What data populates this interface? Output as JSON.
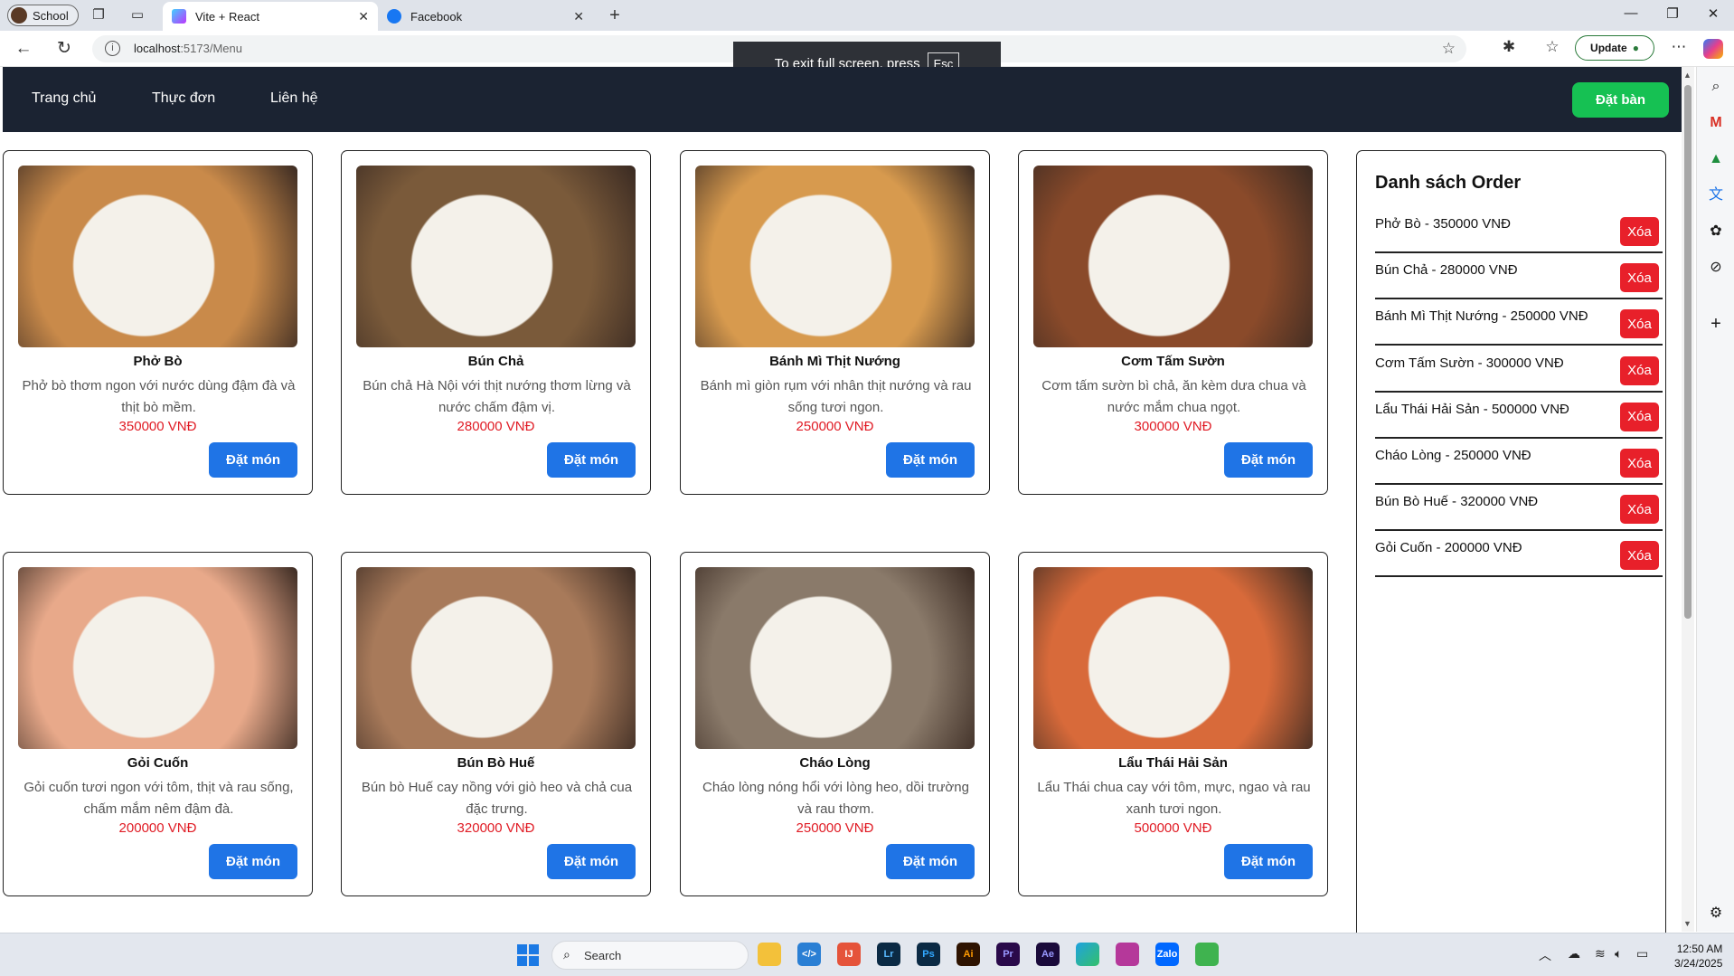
{
  "browser": {
    "profile": "School",
    "tabs": [
      {
        "title": "Vite + React",
        "active": true
      },
      {
        "title": "Facebook",
        "active": false
      }
    ],
    "url_host": "localhost",
    "url_path": ":5173/Menu",
    "update_label": "Update",
    "fullscreen_msg": "To exit full screen, press",
    "fullscreen_key": "Esc"
  },
  "nav": {
    "links": [
      "Trang chủ",
      "Thực đơn",
      "Liên hệ"
    ],
    "book_label": "Đặt bàn"
  },
  "menu": [
    {
      "name": "Phở Bò",
      "desc": "Phở bò thơm ngon với nước dùng đậm đà và thịt bò mềm.",
      "price": "350000 VNĐ",
      "btn": "Đặt món",
      "color": "#c98a4a"
    },
    {
      "name": "Bún Chả",
      "desc": "Bún chả Hà Nội với thịt nướng thơm lừng và nước chấm đậm vị.",
      "price": "280000 VNĐ",
      "btn": "Đặt món",
      "color": "#7a5a3a"
    },
    {
      "name": "Bánh Mì Thịt Nướng",
      "desc": "Bánh mì giòn rụm với nhân thịt nướng và rau sống tươi ngon.",
      "price": "250000 VNĐ",
      "btn": "Đặt món",
      "color": "#d79a4e"
    },
    {
      "name": "Cơm Tấm Sườn",
      "desc": "Cơm tấm sườn bì chả, ăn kèm dưa chua và nước mắm chua ngọt.",
      "price": "300000 VNĐ",
      "btn": "Đặt món",
      "color": "#8a4a2a"
    },
    {
      "name": "Gỏi Cuốn",
      "desc": "Gỏi cuốn tươi ngon với tôm, thịt và rau sống, chấm mắm nêm đậm đà.",
      "price": "200000 VNĐ",
      "btn": "Đặt món",
      "color": "#e8a98a"
    },
    {
      "name": "Bún Bò Huế",
      "desc": "Bún bò Huế cay nồng với giò heo và chả cua đặc trưng.",
      "price": "320000 VNĐ",
      "btn": "Đặt món",
      "color": "#a87a5a"
    },
    {
      "name": "Cháo Lòng",
      "desc": "Cháo lòng nóng hổi với lòng heo, dồi trường và rau thơm.",
      "price": "250000 VNĐ",
      "btn": "Đặt món",
      "color": "#8a7a6a"
    },
    {
      "name": "Lẩu Thái Hải Sản",
      "desc": "Lẩu Thái chua cay với tôm, mực, ngao và rau xanh tươi ngon.",
      "price": "500000 VNĐ",
      "btn": "Đặt món",
      "color": "#d86a3a"
    }
  ],
  "orders": {
    "title": "Danh sách Order",
    "delete_label": "Xóa",
    "items": [
      "Phở Bò - 350000 VNĐ",
      "Bún Chả - 280000 VNĐ",
      "Bánh Mì Thịt Nướng - 250000 VNĐ",
      "Cơm Tấm Sườn - 300000 VNĐ",
      "Lẩu Thái Hải Sản - 500000 VNĐ",
      "Cháo Lòng - 250000 VNĐ",
      "Bún Bò Huế - 320000 VNĐ",
      "Gỏi Cuốn - 200000 VNĐ"
    ]
  },
  "taskbar": {
    "search_label": "Search",
    "time": "12:50 AM",
    "date": "3/24/2025"
  }
}
